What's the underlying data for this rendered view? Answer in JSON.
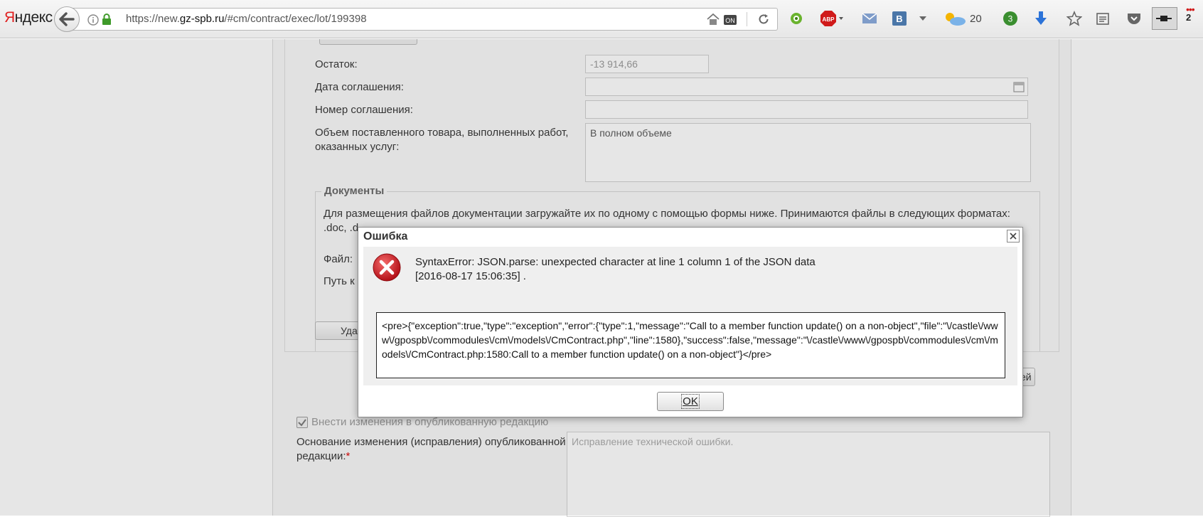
{
  "browser": {
    "brand": "Яндекс",
    "url_prefix": "https://new.",
    "url_domain": "gz-spb.ru",
    "url_path": "/#cm/contract/exec/lot/199398",
    "weather_temp": "20",
    "badge_count": "3",
    "overflow_count": "2"
  },
  "form": {
    "remainder_label": "Остаток:",
    "remainder_value": "-13 914,66",
    "agreement_date_label": "Дата соглашения:",
    "agreement_number_label": "Номер соглашения:",
    "volume_label": "Объем поставленного товара, выполненных работ, оказанных услуг:",
    "volume_value": "В полном объеме",
    "documents_legend": "Документы",
    "documents_info_line1": "Для размещения файлов документации загружайте их по одному с помощью формы ниже. Принимаются файлы в следующих форматах:",
    "documents_info_line2": ".doc, .d",
    "file_label": "Файл:",
    "path_label": "Путь к",
    "delete_button": "Уда",
    "right_button_fragment": "ей",
    "publish_changes_label": "Внести изменения в опубликованную редакцию",
    "reason_label": "Основание изменения (исправления) опубликованной редакции:",
    "reason_required_mark": "*",
    "reason_value": "Исправление технической ошибки."
  },
  "dialog": {
    "title": "Ошибка",
    "message_line1": "SyntaxError: JSON.parse: unexpected character at line 1 column 1 of the JSON data",
    "message_line2": "[2016-08-17 15:06:35] .",
    "detail": "<pre>{\"exception\":true,\"type\":\"exception\",\"error\":{\"type\":1,\"message\":\"Call to a member function update() on a non-object\",\"file\":\"\\/castle\\/www\\/gpospb\\/commodules\\/cm\\/models\\/CmContract.php\",\"line\":1580},\"success\":false,\"message\":\"\\/castle\\/www\\/gpospb\\/commodules\\/cm\\/models\\/CmContract.php:1580:Call to a member function update() on a non-object\"}</pre>",
    "ok_label": "OK"
  },
  "colors": {
    "error_red": "#d9141c",
    "overlay": "#3c3c3c"
  }
}
